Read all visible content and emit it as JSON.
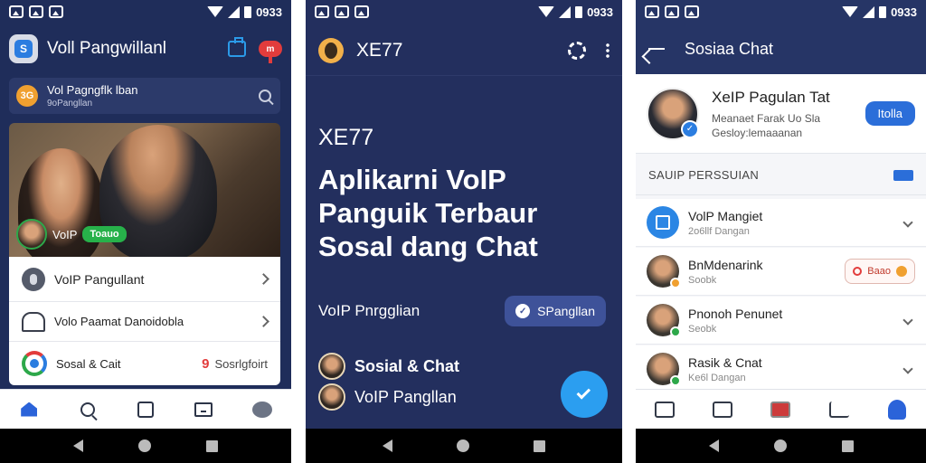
{
  "status": {
    "time": "0933"
  },
  "phone1": {
    "header": {
      "title": "Voll Pangwillanl",
      "badge": "m"
    },
    "search": {
      "logo": "3G",
      "title": "Vol Pagngflk lban",
      "subtitle": "9oPangllan"
    },
    "hero": {
      "label": "VoIP",
      "pill": "Toauo"
    },
    "menu": [
      {
        "label": "VoIP Pangullant"
      },
      {
        "label": "Volo Paamat Danoidobla"
      },
      {
        "label": "Sosal & Cait",
        "badge_count": "9",
        "badge_text": "Sosrlgfoirt"
      }
    ],
    "tabs": [
      "home",
      "search",
      "frame",
      "tray",
      "chat"
    ]
  },
  "phone2": {
    "header": {
      "title": "XE77"
    },
    "subtitle": "XE77",
    "heading": [
      "Aplikarni VoIP",
      "Panguik Terbaur",
      "Sosal dang Chat"
    ],
    "row": {
      "label": "VoIP Pnrgglian",
      "pill": "SPangllan"
    },
    "contacts": [
      {
        "name": "Sosial & Chat"
      },
      {
        "name": "VoIP Pangllan"
      }
    ]
  },
  "phone3": {
    "header": {
      "title": "Sosiaa Chat"
    },
    "profile": {
      "name": "XeIP Pagulan Tat",
      "line1": "Meanaet Farak Uo Sla",
      "line2": "Gesloy:lemaaanan",
      "button": "Itolla"
    },
    "section": {
      "label": "SAUIP PERSSUIAN"
    },
    "list": [
      {
        "name": "VolP Mangiet",
        "sub": "2o6llf Dangan",
        "action": "chevron"
      },
      {
        "name": "BnMdenarink",
        "sub": "Soobk",
        "action": "pill",
        "pill": "Baao"
      },
      {
        "name": "Pnonoh Penunet",
        "sub": "Seobk",
        "action": "chevron"
      },
      {
        "name": "Rasik & Cnat",
        "sub": "Ke6l Dangan",
        "action": "chevron"
      }
    ]
  }
}
